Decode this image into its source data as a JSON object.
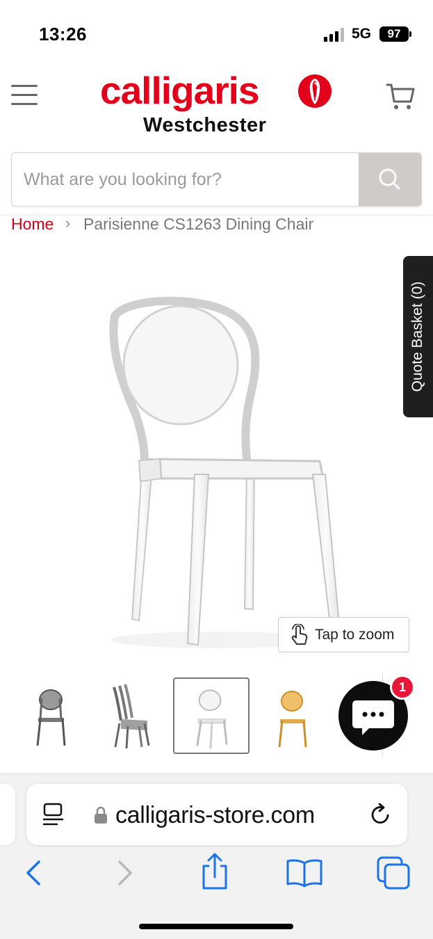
{
  "status_bar": {
    "time": "13:26",
    "network": "5G",
    "battery": "97"
  },
  "header": {
    "brand": "calligaris",
    "location": "Westchester",
    "menu_icon": "hamburger-menu-icon",
    "cart_icon": "shopping-cart-icon",
    "brand_color": "#e3001b"
  },
  "search": {
    "placeholder": "What are you looking for?",
    "value": "",
    "button_icon": "search-icon"
  },
  "breadcrumb": {
    "home": "Home",
    "separator": "›",
    "current": "Parisienne CS1263 Dining Chair"
  },
  "quote_basket": {
    "label": "Quote Basket (0)"
  },
  "product": {
    "zoom_label": "Tap to zoom",
    "zoom_icon": "tap-gesture-icon"
  },
  "thumbnails": [
    {
      "variant": "smoke-grey chair",
      "active": false
    },
    {
      "variant": "stacked chairs",
      "active": false
    },
    {
      "variant": "transparent chair",
      "active": true
    },
    {
      "variant": "amber chair",
      "active": false
    }
  ],
  "chat": {
    "badge": "1",
    "icon": "chat-bubble-icon"
  },
  "browser": {
    "url": "calligaris-store.com",
    "reader_icon": "page-format-icon",
    "lock_icon": "lock-icon",
    "reload_icon": "reload-icon",
    "toolbar_icons": [
      "back-icon",
      "forward-icon",
      "share-icon",
      "bookmarks-icon",
      "tabs-icon"
    ]
  }
}
